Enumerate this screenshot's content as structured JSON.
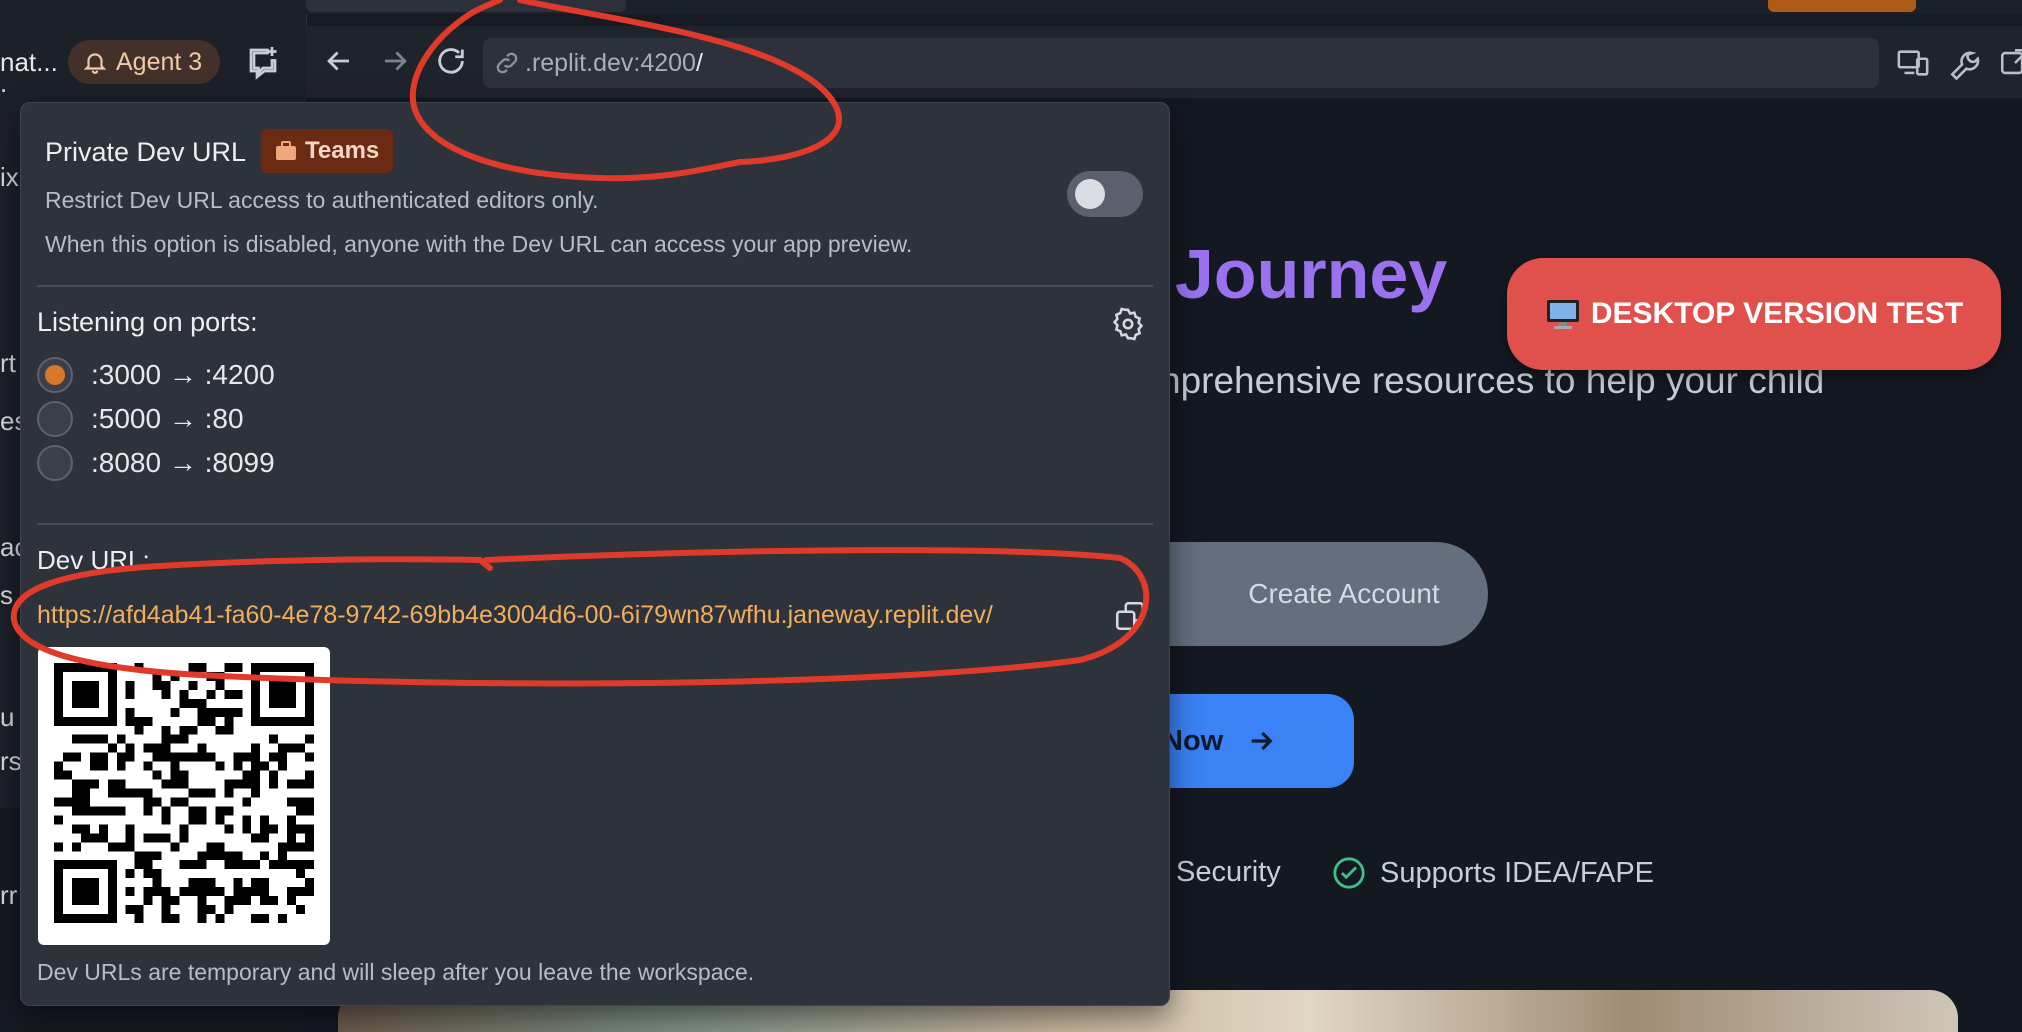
{
  "sidebar": {
    "tab_title_fragment": "nat...",
    "agent_label": "Agent 3",
    "fragments": [
      ".",
      "ix",
      "rt",
      "es",
      "ac",
      "s",
      "u",
      "rs",
      "rr"
    ]
  },
  "browser": {
    "url_prefix": ".replit.dev:4200",
    "url_suffix": "/"
  },
  "page": {
    "hero_title": "P Journey",
    "hero_subtitle": "nprehensive resources to help your child",
    "create_account_label": "Create Account",
    "start_now_label": "Now",
    "features": [
      "Security",
      "Supports IDEA/FAPE"
    ],
    "banner_label": "DESKTOP VERSION TEST"
  },
  "popover": {
    "title": "Private Dev URL",
    "badge_label": "Teams",
    "desc1": "Restrict Dev URL access to authenticated editors only.",
    "desc2": "When this option is disabled, anyone with the Dev URL can access your app preview.",
    "toggle_enabled": false,
    "ports_title": "Listening on ports:",
    "ports": [
      {
        "label": ":3000 → :4200",
        "selected": true
      },
      {
        "label": ":5000 → :80",
        "selected": false
      },
      {
        "label": ":8080 → :8099",
        "selected": false
      }
    ],
    "dev_url_label": "Dev URL:",
    "dev_url": "https://afd4ab41-fa60-4e78-9742-69bb4e3004d6-00-6i79wn87wfhu.janeway.replit.dev/",
    "footer_note": "Dev URLs are temporary and will sleep after you leave the workspace."
  },
  "colors": {
    "accent_orange": "#d9772a",
    "link_orange": "#f0ad5c",
    "banner_red": "#e0514e",
    "hero_purple": "#9a72f0",
    "primary_blue": "#3b82f6",
    "annotation_red": "#e03a2a"
  }
}
